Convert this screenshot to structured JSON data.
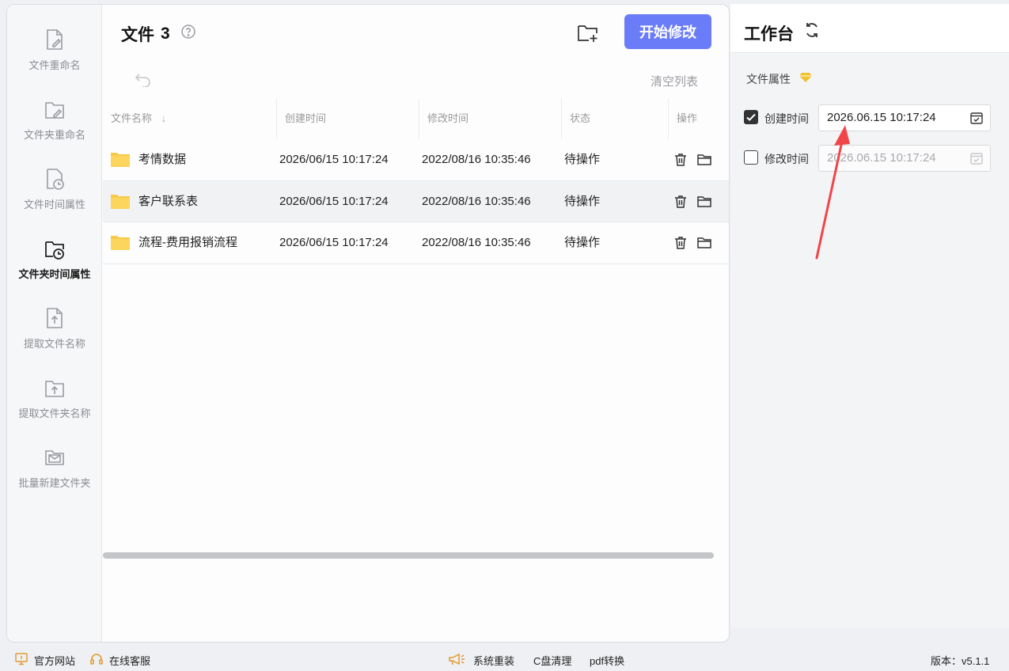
{
  "sidebar": {
    "items": [
      {
        "label": "文件重命名",
        "icon": "file-edit-icon",
        "active": false
      },
      {
        "label": "文件夹重命名",
        "icon": "folder-edit-icon",
        "active": false
      },
      {
        "label": "文件时间属性",
        "icon": "file-clock-icon",
        "active": false
      },
      {
        "label": "文件夹时间属性",
        "icon": "folder-clock-icon",
        "active": true
      },
      {
        "label": "提取文件名称",
        "icon": "file-upload-icon",
        "active": false
      },
      {
        "label": "提取文件夹名称",
        "icon": "folder-upload-icon",
        "active": false
      },
      {
        "label": "批量新建文件夹",
        "icon": "folder-mail-icon",
        "active": false
      }
    ]
  },
  "header": {
    "title": "文件",
    "count": "3",
    "start_button": "开始修改",
    "clear_list": "清空列表"
  },
  "table": {
    "columns": [
      "文件名称",
      "创建时间",
      "修改时间",
      "状态",
      "操作"
    ],
    "rows": [
      {
        "name": "考情数据",
        "created": "2026/06/15 10:17:24",
        "modified": "2022/08/16 10:35:46",
        "status": "待操作"
      },
      {
        "name": "客户联系表",
        "created": "2026/06/15 10:17:24",
        "modified": "2022/08/16 10:35:46",
        "status": "待操作"
      },
      {
        "name": "流程-费用报销流程",
        "created": "2026/06/15 10:17:24",
        "modified": "2022/08/16 10:35:46",
        "status": "待操作"
      }
    ]
  },
  "workbench": {
    "title": "工作台",
    "section_label": "文件属性",
    "created": {
      "label": "创建时间",
      "value": "2026.06.15 10:17:24",
      "checked": true
    },
    "modified": {
      "label": "修改时间",
      "value": "2026.06.15 10:17:24",
      "checked": false
    }
  },
  "footer": {
    "website": "官方网站",
    "support": "在线客服",
    "reinstall": "系统重装",
    "cleanup": "C盘清理",
    "pdf": "pdf转换",
    "version": "版本：v5.1.1"
  },
  "colors": {
    "accent": "#6a7cf7",
    "folder": "#f7c948",
    "arrow": "#f0464a",
    "gem": "#f2c12e"
  }
}
